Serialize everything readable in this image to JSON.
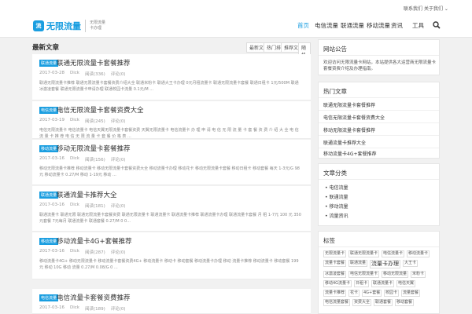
{
  "topbar": {
    "link1": "联系我们",
    "link2": "关于我们 ⌄"
  },
  "logo": {
    "mark": "流",
    "text": "无限流量",
    "slogan": "无限流量 卡办理"
  },
  "nav": [
    "首页",
    "电信流量",
    "联通流量",
    "移动流量",
    "资讯",
    "工具"
  ],
  "main": {
    "title": "最新文章",
    "sorts": [
      "最新文章",
      "热门排行",
      "推荐文章",
      "随机文章"
    ],
    "posts": [
      {
        "cat": "联通流量",
        "title": "联通无限流量卡套餐推荐",
        "date": "2017-03-28",
        "author": "Dick",
        "views": "阅读(336)",
        "comments": "评论(0)",
        "excerpt": "联通无限流量卡推荐 联通无限流量卡套餐资费介绍大全 联通米粉卡 联通大王卡办理 0元月租流量卡 联通无限流量卡套餐 联通日租卡 1元/500M 联通冰激凌套餐 联通无限流量卡申请办理 联通校园卡流量 0.1元/M ..."
      },
      {
        "cat": "电信流量",
        "title": "电信无限流量卡套餐资费大全",
        "date": "2017-03-19",
        "author": "Dick",
        "views": "阅读(245)",
        "comments": "评论(0)",
        "excerpt": "电信无限流量卡 电信流量卡 电信天翼无限流量卡套餐资费 天翼无限流量卡 电信流量卡 办 理 申 请 电 信 无 限 流 量 卡 套 餐 资 费 介 绍 大 全 电 信 流 量 卡 推 荐 电 信 无 限 流 量 卡 套 餐 价 格 表 ..."
      },
      {
        "cat": "移动流量",
        "title": "移动无限流量卡套餐推荐",
        "date": "2017-03-16",
        "author": "Dick",
        "views": "阅读(156)",
        "comments": "评论(0)",
        "excerpt": "移动无限流量卡推荐 移动流量卡 移动无限流量卡套餐资费大全 移动流量卡办理 移动花卡 移动无限流量卡套餐 移动日租卡 移动套餐 每天 1-3元/G 98元 移动流量卡 0.27/M 移动 1-19元 移动 ..."
      },
      {
        "cat": "联通流量",
        "title": "联通流量卡推荐大全",
        "date": "2017-03-16",
        "author": "Dick",
        "views": "阅读(181)",
        "comments": "评论(0)",
        "excerpt": "联通流量卡 联通无限 联通无限流量卡套餐资费 联通无限流量卡 联通流量卡 联通流量卡推荐 联通流量卡办理 联通流量卡套餐 月 租 1-7元 100 元 350元套餐 7元每月 联通流量卡 联通套餐 0.27/M 0 0..."
      },
      {
        "cat": "移动流量",
        "title": "移动流量卡4G+套餐推荐",
        "date": "2017-03-16",
        "author": "Dick",
        "views": "阅读(287)",
        "comments": "评论(0)",
        "excerpt": "移动流量卡4G+ 移动无限流量卡 移动流量卡套餐资费4G+ 移动流量卡 移动卡 移动套餐 移动流量卡办理 移动 流量卡推荐 移动流量卡 移动套餐 199元 移动 10G 移动 流量 0.27/M 0.08/G 0 ..."
      },
      {
        "cat": "电信流量",
        "title": "电信流量卡套餐资费推荐",
        "date": "2017-03-16",
        "author": "Dick",
        "views": "阅读(189)",
        "comments": "评论(0)",
        "excerpt": ""
      }
    ]
  },
  "side": {
    "notice_title": "网站公告",
    "notice_text": "欢迎访问无限流量卡网站，本站提供各大运营商无限流量卡套餐资费介绍及办理指南。",
    "hot_title": "热门文章",
    "hot": [
      "联通无限流量卡套餐推荐",
      "电信无限流量卡套餐资费大全",
      "移动无限流量卡套餐推荐",
      "联通流量卡推荐大全",
      "移动流量卡4G+套餐推荐"
    ],
    "cat_title": "文章分类",
    "cats": [
      "电信流量",
      "联通流量",
      "移动流量",
      "流量资讯"
    ],
    "tag_title": "标签",
    "tags": [
      {
        "t": "无限流量卡",
        "s": ""
      },
      {
        "t": "联通无限流量卡",
        "s": ""
      },
      {
        "t": "电信流量卡",
        "s": ""
      },
      {
        "t": "移动流量卡",
        "s": ""
      },
      {
        "t": "流量卡套餐",
        "s": ""
      },
      {
        "t": "联通流量",
        "s": ""
      },
      {
        "t": "流量卡办理",
        "s": "mid"
      },
      {
        "t": "大王卡",
        "s": ""
      },
      {
        "t": "冰激凌套餐",
        "s": ""
      },
      {
        "t": "电信无限流量卡",
        "s": ""
      },
      {
        "t": "移动无限流量",
        "s": ""
      },
      {
        "t": "米粉卡",
        "s": ""
      },
      {
        "t": "移动4G流量卡",
        "s": ""
      },
      {
        "t": "日租卡",
        "s": ""
      },
      {
        "t": "联通流量卡",
        "s": ""
      },
      {
        "t": "电信天翼",
        "s": ""
      },
      {
        "t": "流量卡推荐",
        "s": ""
      },
      {
        "t": "花卡",
        "s": ""
      },
      {
        "t": "4G+套餐",
        "s": ""
      },
      {
        "t": "校园卡",
        "s": ""
      },
      {
        "t": "流量套餐",
        "s": ""
      },
      {
        "t": "电信流量套餐",
        "s": ""
      },
      {
        "t": "资费大全",
        "s": ""
      },
      {
        "t": "联通套餐",
        "s": ""
      },
      {
        "t": "移动套餐",
        "s": ""
      },
      {
        "t": "流量卡",
        "s": "big"
      },
      {
        "t": "流量资讯",
        "s": ""
      },
      {
        "t": "运营商套餐",
        "s": ""
      },
      {
        "t": "无限流量",
        "s": ""
      },
      {
        "t": "移动流量",
        "s": ""
      }
    ]
  }
}
